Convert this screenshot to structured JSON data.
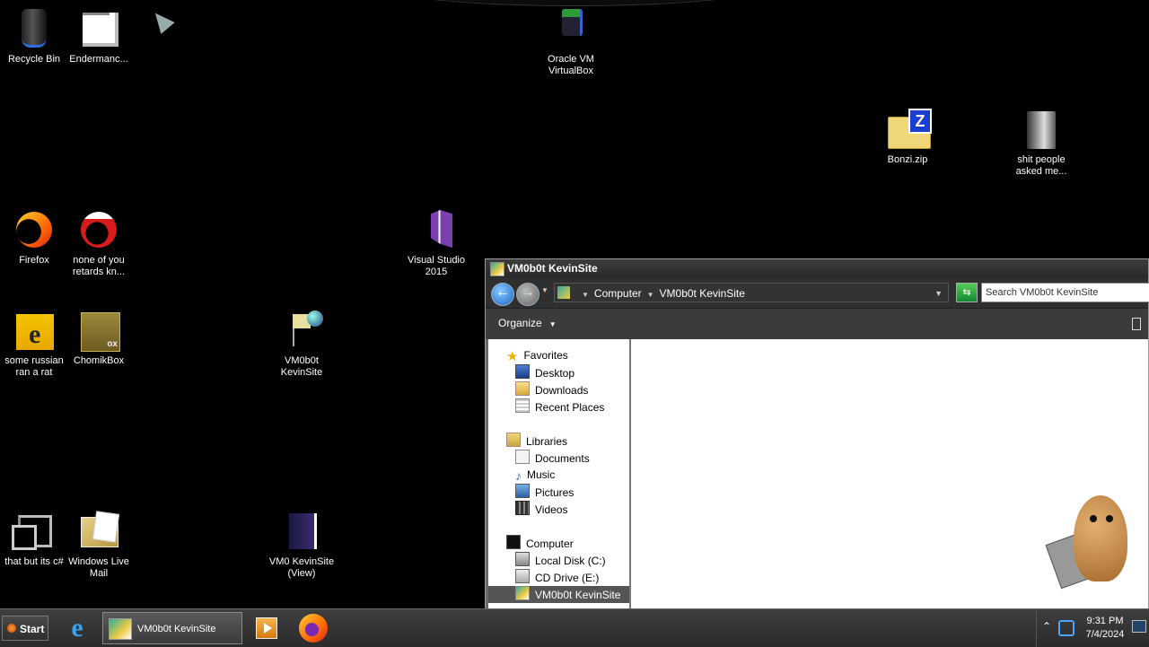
{
  "desktop": {
    "icons": [
      {
        "label": "Recycle Bin"
      },
      {
        "label": "Endermanc..."
      },
      {
        "label": "Oracle VM\nVirtualBox"
      },
      {
        "label": "Bonzi.zip"
      },
      {
        "label": "shit people\nasked me..."
      },
      {
        "label": "Firefox"
      },
      {
        "label": "none of you\nretards kn..."
      },
      {
        "label": "Visual Studio\n2015"
      },
      {
        "label": "some russian\nran a rat"
      },
      {
        "label": "ChomikBox"
      },
      {
        "label": "VM0b0t\nKevinSite"
      },
      {
        "label": "that but its c#"
      },
      {
        "label": "Windows Live\nMail"
      },
      {
        "label": "VM0 KevinSite\n(View)"
      }
    ]
  },
  "explorer": {
    "title": "VM0b0t KevinSite",
    "breadcrumb": [
      "Computer",
      "VM0b0t KevinSite"
    ],
    "search_placeholder": "Search VM0b0t KevinSite",
    "organize_label": "Organize",
    "nav": {
      "favorites": {
        "label": "Favorites",
        "items": [
          "Desktop",
          "Downloads",
          "Recent Places"
        ]
      },
      "libraries": {
        "label": "Libraries",
        "items": [
          "Documents",
          "Music",
          "Pictures",
          "Videos"
        ]
      },
      "computer": {
        "label": "Computer",
        "items": [
          "Local Disk (C:)",
          "CD Drive (E:)",
          "VM0b0t KevinSite"
        ]
      }
    },
    "selected_nav_item": "VM0b0t KevinSite"
  },
  "taskbar": {
    "start_label": "Start",
    "active_task_label": "VM0b0t KevinSite",
    "clock_time": "9:31 PM",
    "clock_date": "7/4/2024"
  }
}
